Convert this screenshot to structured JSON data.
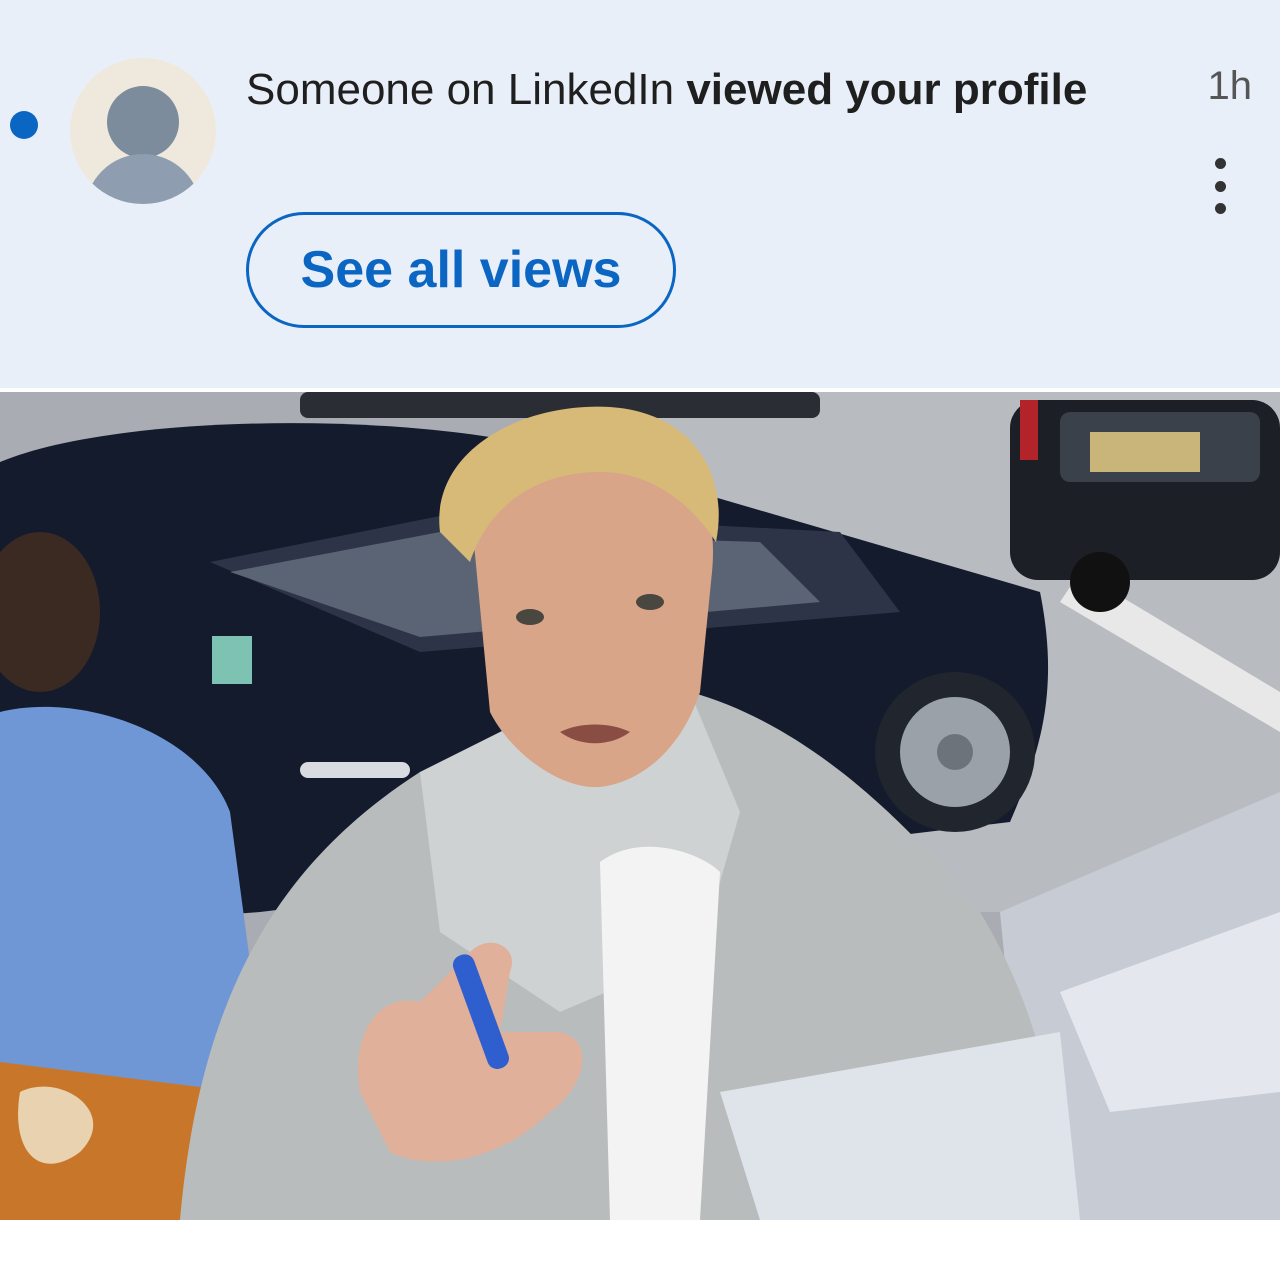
{
  "notification": {
    "message_plain": "Someone on LinkedIn ",
    "message_bold": "viewed your profile",
    "time": "1h",
    "button_label": "See all views",
    "accent_color": "#0a66c2",
    "icons": [
      "unread-dot",
      "default-avatar-icon",
      "more-options-icon"
    ]
  },
  "photo": {
    "kind": "street photograph"
  }
}
